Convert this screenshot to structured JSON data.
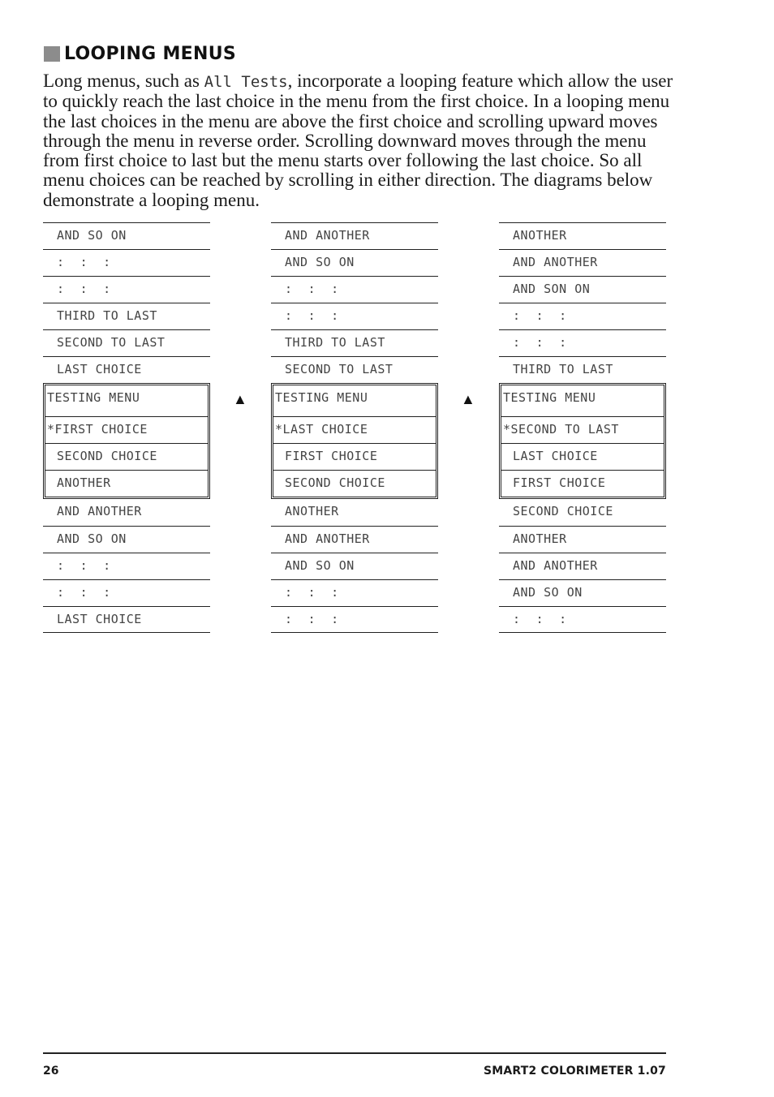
{
  "section": {
    "title": "LOOPING MENUS",
    "paragraph_parts": {
      "before": "Long menus, such as ",
      "code": "All Tests",
      "after": ", incorporate a looping feature which allow the user to quickly reach the last choice in the menu from the first choice. In a looping menu the last choices in the menu are above the first choice and scrolling upward moves through the menu in reverse order. Scrolling downward moves through the menu from first choice to last but the menu starts over following the last choice. So all menu choices can be reached by scrolling in either direction. The diagrams below demonstrate a looping menu."
    }
  },
  "diagrams": [
    {
      "above": [
        "AND SO ON",
        ":  :  :",
        ":  :  :",
        "THIRD TO LAST",
        "SECOND TO LAST",
        "LAST CHOICE"
      ],
      "screen": {
        "header": "TESTING MENU",
        "selected": "*FIRST CHOICE",
        "items": [
          "SECOND CHOICE",
          "ANOTHER"
        ]
      },
      "below": [
        "AND ANOTHER",
        "AND SO ON",
        ":  :  :",
        ":  :  :",
        "LAST CHOICE"
      ]
    },
    {
      "above": [
        "AND ANOTHER",
        "AND SO ON",
        ":  :  :",
        ":  :  :",
        "THIRD TO LAST",
        "SECOND TO LAST"
      ],
      "screen": {
        "header": "TESTING MENU",
        "selected": "*LAST CHOICE",
        "items": [
          "FIRST CHOICE",
          "SECOND CHOICE"
        ]
      },
      "below": [
        "ANOTHER",
        "AND ANOTHER",
        "AND SO ON",
        ":  :  :",
        ":  :  :"
      ]
    },
    {
      "above": [
        "ANOTHER",
        "AND ANOTHER",
        "AND SON ON",
        ":  :  :",
        ":  :  :",
        "THIRD TO LAST"
      ],
      "screen": {
        "header": "TESTING MENU",
        "selected": "*SECOND TO LAST",
        "items": [
          "LAST CHOICE",
          "FIRST CHOICE"
        ]
      },
      "below": [
        "SECOND CHOICE",
        "ANOTHER",
        "AND ANOTHER",
        "AND SO ON",
        ":  :  :"
      ]
    }
  ],
  "arrows": [
    "▲",
    "▲"
  ],
  "footer": {
    "page_number": "26",
    "document_title": "SMART2 COLORIMETER  1.07"
  }
}
